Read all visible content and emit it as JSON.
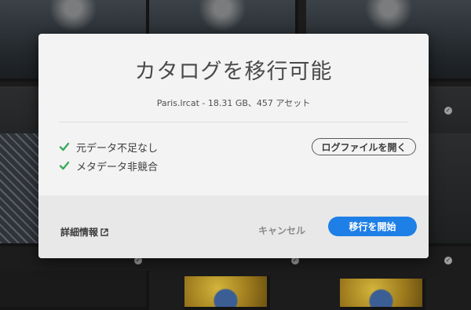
{
  "dialog": {
    "title": "カタログを移行可能",
    "subtitle": "Paris.lrcat - 18.31 GB、457 アセット",
    "checks": [
      {
        "label": "元データ不足なし"
      },
      {
        "label": "メタデータ非競合"
      }
    ],
    "open_log_label": "ログファイルを開く",
    "details_label": "詳細情報",
    "cancel_label": "キャンセル",
    "start_label": "移行を開始"
  },
  "colors": {
    "accent": "#1e7fe6",
    "check": "#3aaa5a"
  },
  "icons": [
    "check-icon",
    "external-link-icon",
    "checkmark-badge-icon"
  ]
}
